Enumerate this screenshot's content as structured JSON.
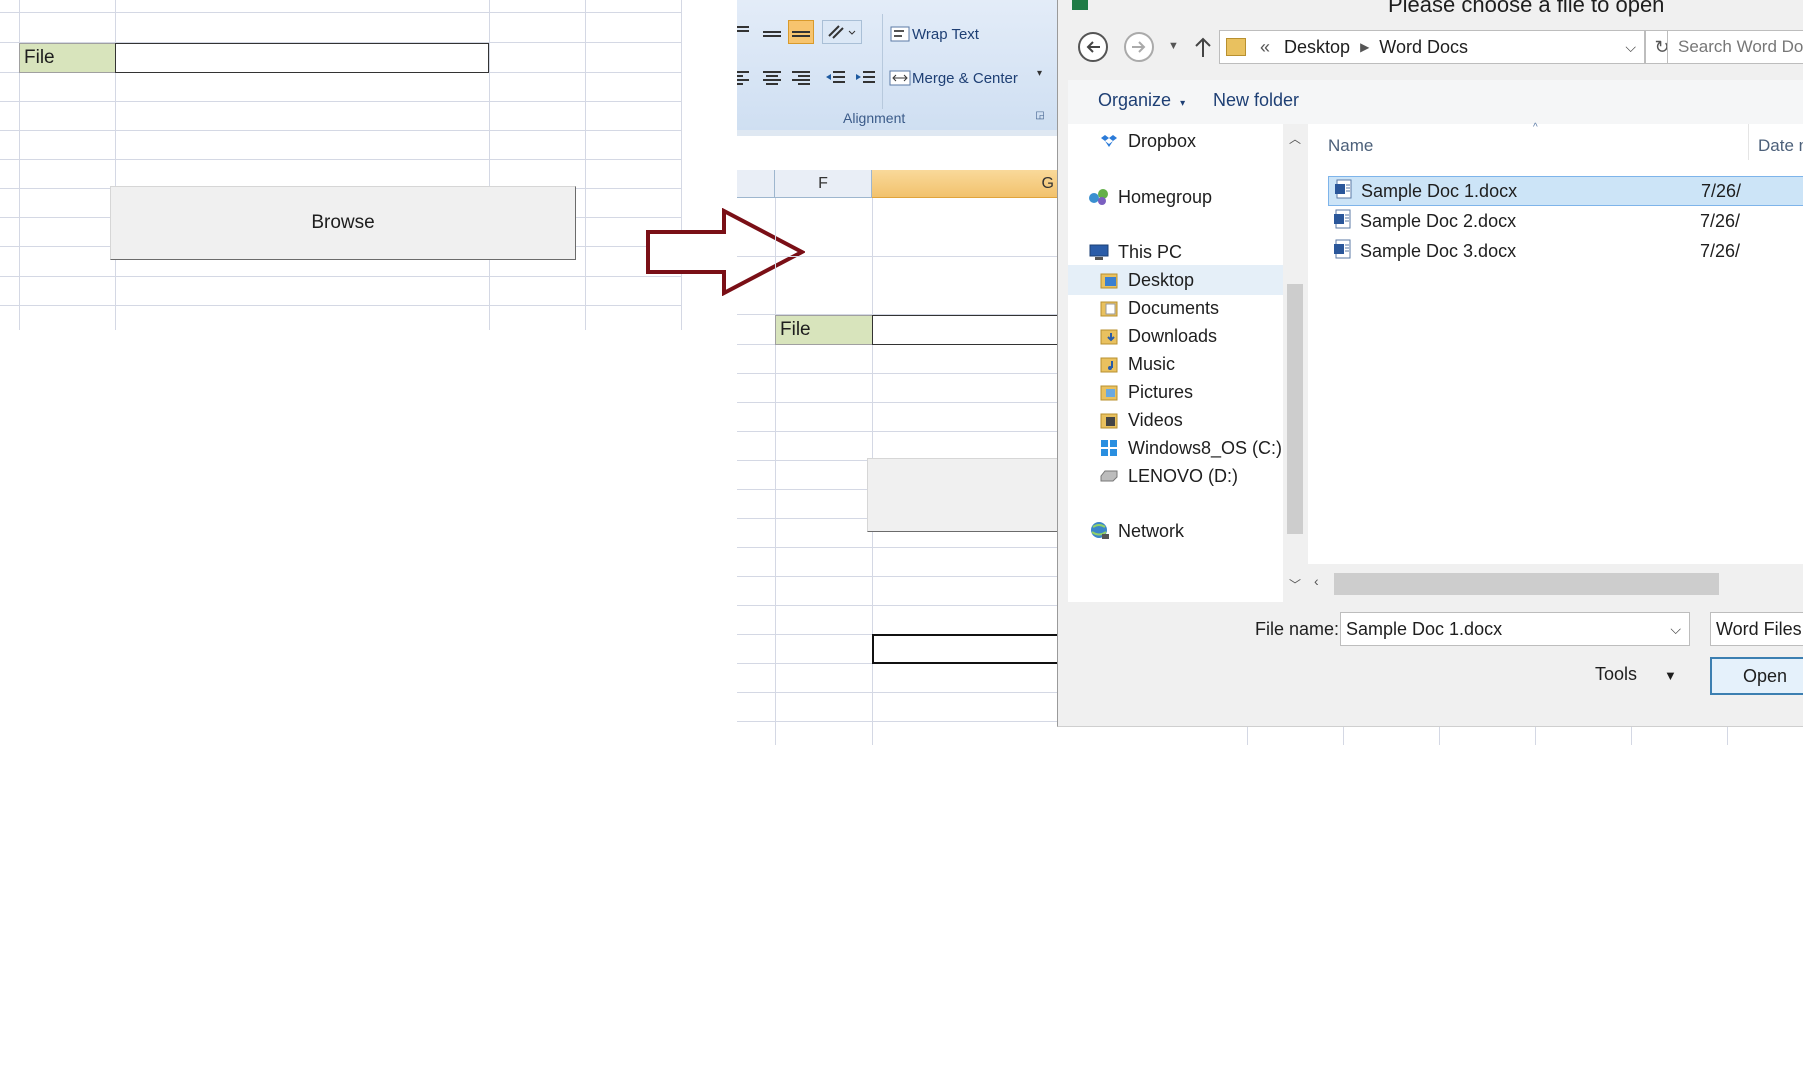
{
  "left_sheet": {
    "file_label": "File",
    "file_value": "",
    "browse_label": "Browse"
  },
  "ribbon": {
    "wrap_text": "Wrap Text",
    "merge_center": "Merge & Center",
    "group_label": "Alignment"
  },
  "right_sheet": {
    "col_f": "F",
    "col_g": "G",
    "file_label": "File",
    "file_value": ""
  },
  "dialog": {
    "title": "Please choose a file to open",
    "breadcrumb": [
      "Desktop",
      "Word Docs"
    ],
    "breadcrumb_overflow": "«",
    "search_placeholder": "Search Word Docs",
    "organize": "Organize",
    "new_folder": "New folder",
    "nav_items": [
      {
        "label": "Dropbox",
        "icon": "dropbox-icon"
      },
      {
        "label": "Homegroup",
        "icon": "homegroup-icon"
      },
      {
        "label": "This PC",
        "icon": "computer-icon"
      },
      {
        "label": "Desktop",
        "icon": "folder-icon",
        "selected": true
      },
      {
        "label": "Documents",
        "icon": "folder-icon"
      },
      {
        "label": "Downloads",
        "icon": "folder-icon"
      },
      {
        "label": "Music",
        "icon": "folder-icon"
      },
      {
        "label": "Pictures",
        "icon": "folder-icon"
      },
      {
        "label": "Videos",
        "icon": "folder-icon"
      },
      {
        "label": "Windows8_OS (C:)",
        "icon": "drive-c-icon"
      },
      {
        "label": "LENOVO (D:)",
        "icon": "drive-icon"
      },
      {
        "label": "Network",
        "icon": "network-icon"
      }
    ],
    "columns": {
      "name": "Name",
      "date": "Date modified"
    },
    "files": [
      {
        "name": "Sample Doc 1.docx",
        "date": "7/26/",
        "selected": true
      },
      {
        "name": "Sample Doc 2.docx",
        "date": "7/26/"
      },
      {
        "name": "Sample Doc 3.docx",
        "date": "7/26/"
      }
    ],
    "file_name_label": "File name:",
    "file_name_value": "Sample Doc 1.docx",
    "file_type": "Word Files *.docx",
    "tools": "Tools",
    "open": "Open"
  },
  "colors": {
    "label_fill": "#d8e4bc",
    "arrow": "#7a0f16",
    "selection": "#cce4f7",
    "selected_col": "#f2c26d"
  }
}
